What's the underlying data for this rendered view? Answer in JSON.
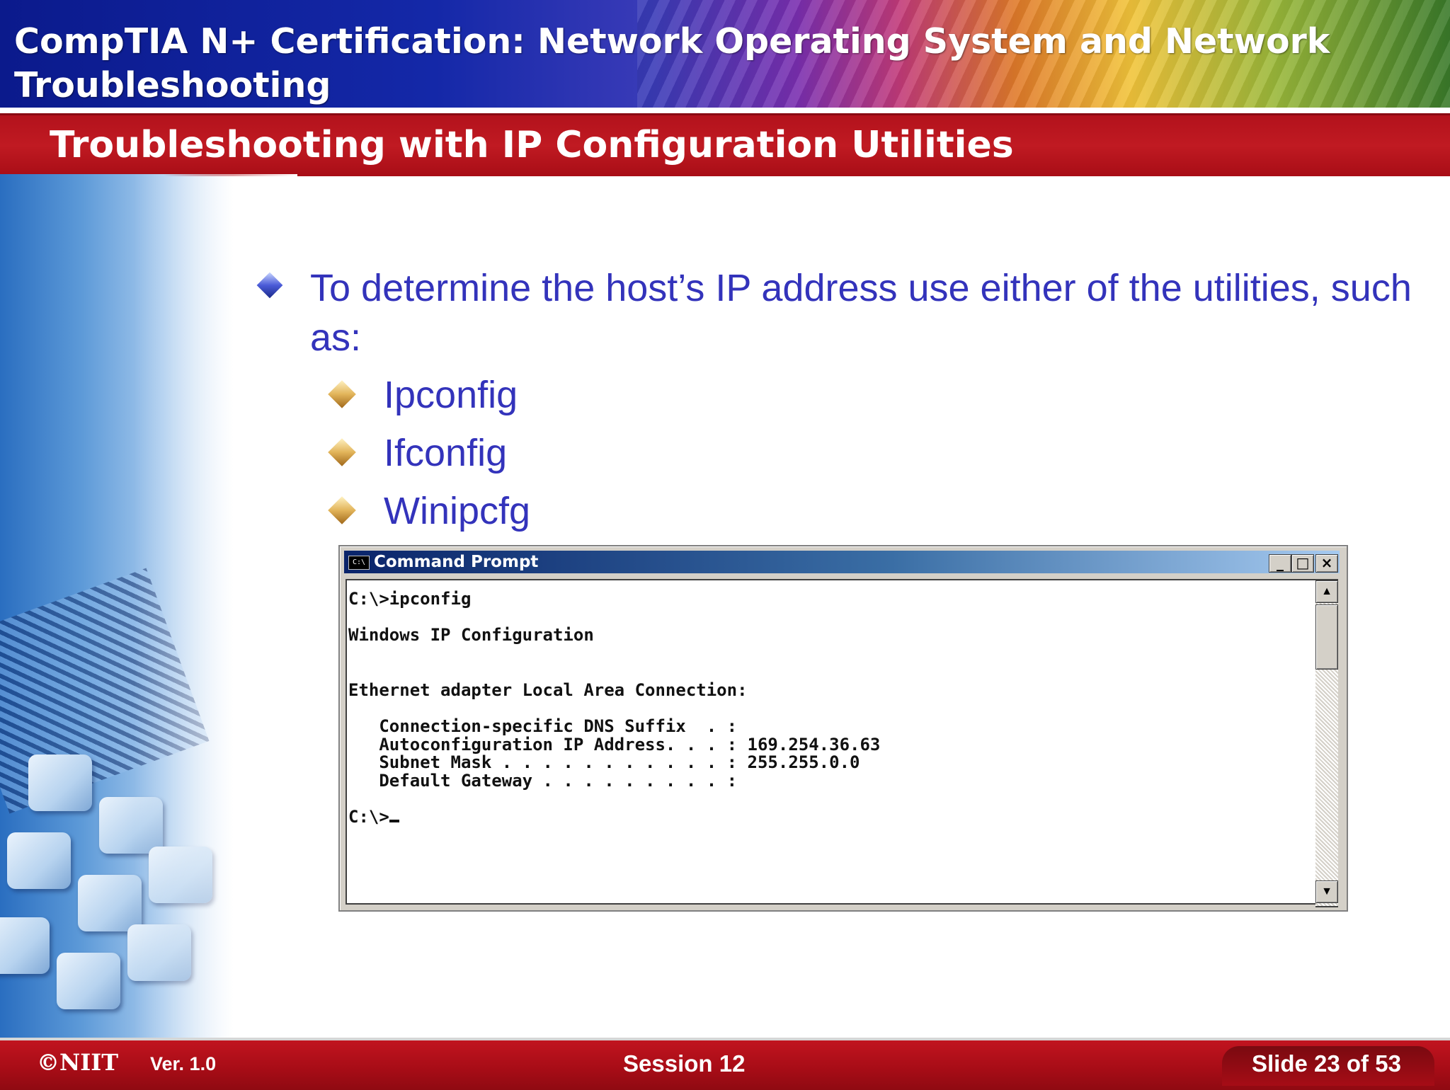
{
  "header": {
    "title": "CompTIA N+ Certification:  Network  Operating System and Network Troubleshooting"
  },
  "slide": {
    "title": "Troubleshooting with IP Configuration Utilities",
    "bullet_main": "To determine the host’s IP address use either of the utilities, such as:",
    "sub_bullets": [
      "Ipconfig",
      "Ifconfig",
      "Winipcfg"
    ]
  },
  "command_prompt": {
    "window_title": "Command Prompt",
    "icon_label": "C:\\",
    "buttons": {
      "minimize": "_",
      "maximize": "□",
      "close": "×"
    },
    "lines": [
      "C:\\>ipconfig",
      "",
      "Windows IP Configuration",
      "",
      "",
      "Ethernet adapter Local Area Connection:",
      "",
      "   Connection-specific DNS Suffix  . :",
      "   Autoconfiguration IP Address. . . : 169.254.36.63",
      "   Subnet Mask . . . . . . . . . . . : 255.255.0.0",
      "   Default Gateway . . . . . . . . . :",
      "",
      "C:\\>"
    ]
  },
  "footer": {
    "logo": "©NIIT",
    "version": "Ver.  1.0",
    "session": "Session 12",
    "slide_number": "Slide 23 of 53"
  },
  "colors": {
    "title_bar": "#b3121c",
    "bullet_text": "#3333bb",
    "footer": "#a60c16"
  }
}
